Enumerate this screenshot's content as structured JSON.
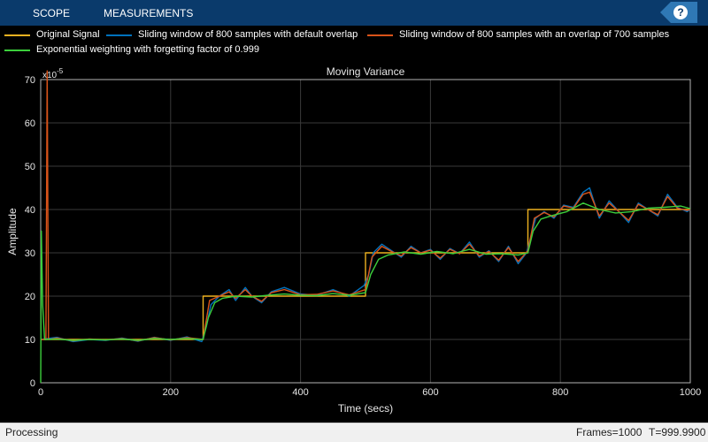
{
  "toolstrip": {
    "tabs": [
      "SCOPE",
      "MEASUREMENTS"
    ],
    "help_label": "?"
  },
  "legend": [
    {
      "name": "Original Signal",
      "color": "#edb120"
    },
    {
      "name": "Sliding window of 800 samples with default overlap",
      "color": "#0072bd"
    },
    {
      "name": "Sliding window of 800 samples with an overlap of 700 samples",
      "color": "#d95319"
    },
    {
      "name": "Exponential weighting with forgetting factor of 0.999",
      "color": "#3ccf3c"
    }
  ],
  "status": {
    "state": "Processing",
    "frames": "Frames=1000",
    "time": "T=999.9900"
  },
  "chart_data": {
    "type": "line",
    "title": "Moving Variance",
    "xlabel": "Time (secs)",
    "ylabel": "Amplitude",
    "exponent_label": "x10",
    "exponent_power": "-5",
    "xlim": [
      0,
      1000
    ],
    "ylim": [
      0,
      70
    ],
    "xticks": [
      0,
      200,
      400,
      600,
      800,
      1000
    ],
    "yticks": [
      0,
      10,
      20,
      30,
      40,
      50,
      60,
      70
    ],
    "grid": true,
    "background": "#000000",
    "axes_color": "#b3b3b3",
    "grid_color": "#3a3a3a",
    "series": [
      {
        "name": "Original Signal",
        "color": "#edb120",
        "x": [
          0,
          250,
          250,
          500,
          500,
          750,
          750,
          1000
        ],
        "y": [
          10,
          10,
          20,
          20,
          30,
          30,
          40,
          40
        ]
      },
      {
        "name": "Sliding window of 800 samples with default overlap",
        "color": "#0072bd",
        "x": [
          0,
          25,
          50,
          75,
          100,
          125,
          150,
          175,
          200,
          225,
          248,
          255,
          262,
          275,
          290,
          300,
          315,
          325,
          340,
          355,
          375,
          400,
          425,
          450,
          475,
          498,
          505,
          512,
          525,
          540,
          555,
          570,
          585,
          600,
          615,
          630,
          645,
          660,
          675,
          690,
          705,
          720,
          735,
          748,
          755,
          762,
          775,
          790,
          805,
          820,
          835,
          845,
          860,
          875,
          890,
          905,
          920,
          935,
          950,
          965,
          980,
          995,
          1000
        ],
        "y": [
          10,
          10.5,
          9.5,
          10,
          9.8,
          10.3,
          9.6,
          10.5,
          9.8,
          10.6,
          9.5,
          13,
          18,
          20,
          21.5,
          19,
          22,
          20,
          18.5,
          21,
          22,
          20.5,
          20.2,
          21.5,
          20,
          22.5,
          25,
          30,
          32,
          30.5,
          29,
          31.5,
          30,
          30.8,
          28.5,
          31,
          29.8,
          32.5,
          29,
          30.5,
          28,
          31.5,
          27.5,
          30,
          34,
          38,
          39.5,
          38,
          41,
          40.5,
          44,
          45,
          38,
          42,
          39.5,
          37,
          41.5,
          40,
          38.5,
          43.5,
          40.5,
          39.5,
          40
        ]
      },
      {
        "name": "Sliding window of 800 samples with an overlap of 700 samples",
        "color": "#d95319",
        "x": [
          0,
          8,
          10,
          12,
          25,
          50,
          75,
          100,
          125,
          150,
          175,
          200,
          225,
          250,
          260,
          275,
          290,
          300,
          315,
          325,
          340,
          355,
          375,
          400,
          425,
          450,
          475,
          500,
          510,
          525,
          540,
          555,
          570,
          585,
          600,
          615,
          630,
          645,
          660,
          675,
          690,
          705,
          720,
          735,
          750,
          760,
          775,
          790,
          805,
          820,
          835,
          845,
          860,
          875,
          890,
          905,
          920,
          935,
          950,
          965,
          980,
          995,
          1000
        ],
        "y": [
          10,
          10,
          72,
          10,
          10.3,
          9.7,
          10.1,
          9.9,
          10.2,
          9.7,
          10.4,
          9.9,
          10.4,
          10,
          19,
          20,
          21,
          19.5,
          21.5,
          20,
          18.8,
          20.8,
          21.5,
          20.3,
          20.4,
          21.2,
          20.3,
          21.5,
          29,
          31.5,
          30.3,
          29.3,
          31.2,
          30,
          30.6,
          28.8,
          30.8,
          29.8,
          32,
          29.3,
          30.3,
          28.3,
          31.2,
          28,
          30.5,
          38,
          39.3,
          38.3,
          40.8,
          40.3,
          43.5,
          44,
          38.5,
          41.5,
          39.5,
          37.5,
          41.2,
          40,
          38.8,
          43,
          40.3,
          39.8,
          40
        ]
      },
      {
        "name": "Exponential weighting with forgetting factor of 0.999",
        "color": "#3ccf3c",
        "x": [
          0,
          1,
          3,
          6,
          25,
          50,
          75,
          100,
          125,
          150,
          175,
          200,
          225,
          250,
          258,
          268,
          280,
          300,
          325,
          350,
          375,
          400,
          425,
          450,
          475,
          500,
          508,
          520,
          535,
          560,
          585,
          610,
          635,
          660,
          685,
          710,
          735,
          750,
          758,
          770,
          785,
          810,
          835,
          860,
          885,
          910,
          935,
          960,
          985,
          1000
        ],
        "y": [
          0,
          35,
          18,
          10,
          10.1,
          9.8,
          10,
          9.9,
          10.1,
          9.8,
          10.2,
          10,
          10.2,
          10,
          15,
          18.5,
          19.5,
          20,
          19.8,
          20.2,
          20.5,
          20.2,
          20.1,
          20.6,
          20.2,
          20.8,
          25,
          28.5,
          29.5,
          30.2,
          29.7,
          30.3,
          29.8,
          30.8,
          29.7,
          29.8,
          29.5,
          30,
          35,
          37.8,
          38.5,
          39.5,
          41.5,
          40,
          39.2,
          39.5,
          40.3,
          40.5,
          40.8,
          40.2
        ]
      }
    ]
  }
}
